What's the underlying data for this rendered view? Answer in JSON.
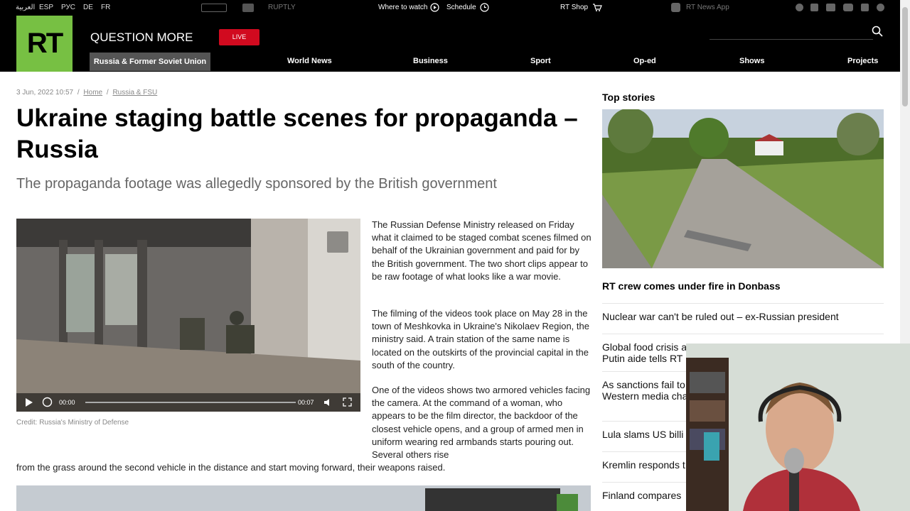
{
  "topbar": {
    "languages": [
      "العربية",
      "ESP",
      "РУС",
      "DE",
      "FR"
    ],
    "channels": [
      "RUPTLY"
    ],
    "where_to_watch": "Where to watch",
    "schedule": "Schedule",
    "shop": "RT Shop",
    "news_app": "RT News App"
  },
  "header": {
    "logo": "RT",
    "tagline": "QUESTION MORE",
    "live": "LIVE",
    "nav": [
      "Russia & Former Soviet Union",
      "World News",
      "Business",
      "Sport",
      "Op-ed",
      "Shows",
      "Projects"
    ]
  },
  "article": {
    "date": "3 Jun, 2022 10:57",
    "breadcrumb": [
      "Home",
      "Russia & FSU"
    ],
    "title": "Ukraine staging battle scenes for propaganda – Russia",
    "subtitle": "The propaganda footage was allegedly sponsored by the British government",
    "video": {
      "time_current": "00:00",
      "time_total": "00:07"
    },
    "credit": "Credit: Russia's Ministry of Defense",
    "paragraphs": [
      "The Russian Defense Ministry released on Friday what it claimed to be staged combat scenes filmed on behalf of the Ukrainian government and paid for by the British government. The two short clips appear to be raw footage of what looks like a war movie.",
      "The filming of the videos took place on May 28 in the town of Meshkovka in Ukraine's Nikolaev Region, the ministry said. A train station of the same name is located on the outskirts of the provincial capital in the south of the country.",
      "One of the videos shows two armored vehicles facing the camera. At the command of a woman, who appears to be the film director, the backdoor of the closest vehicle opens, and a group of armed men in uniform wearing red armbands starts pouring out. Several others rise",
      "from the grass around the second vehicle in the distance and start moving forward, their weapons raised."
    ]
  },
  "sidebar": {
    "heading": "Top stories",
    "lead": "RT crew comes under fire in Donbass",
    "stories": [
      "Nuclear war can't be ruled out – ex-Russian president",
      "Global food crisis a",
      "Putin aide tells RT",
      "As sanctions fail to",
      "Western media cha",
      "Lula slams US billi",
      "Kremlin responds t",
      "Finland compares"
    ]
  },
  "colors": {
    "brand": "#77c043",
    "live": "#d10a1f",
    "header_bg": "#000000"
  }
}
